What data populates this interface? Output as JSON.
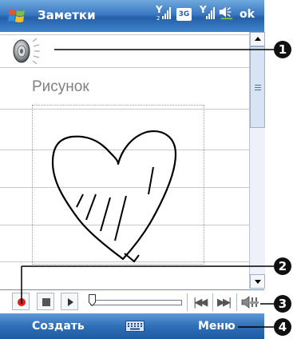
{
  "titlebar": {
    "title": "Заметки",
    "network_badge": "3G",
    "ok_label": "ok"
  },
  "note": {
    "drawing_label": "Рисунок"
  },
  "menubar": {
    "left_softkey": "Создать",
    "right_softkey": "Меню"
  },
  "callouts": [
    "1",
    "2",
    "3",
    "4"
  ],
  "colors": {
    "titlebar_blue": "#3b78c3",
    "record_red": "#e21f1f",
    "rule_gray": "#c8c8c8"
  },
  "icons": [
    "windows-start-icon",
    "signal-icon",
    "volume-icon",
    "speaker-recording-icon",
    "record-icon",
    "stop-icon",
    "play-icon",
    "skip-back-icon",
    "skip-forward-icon",
    "keyboard-icon"
  ]
}
